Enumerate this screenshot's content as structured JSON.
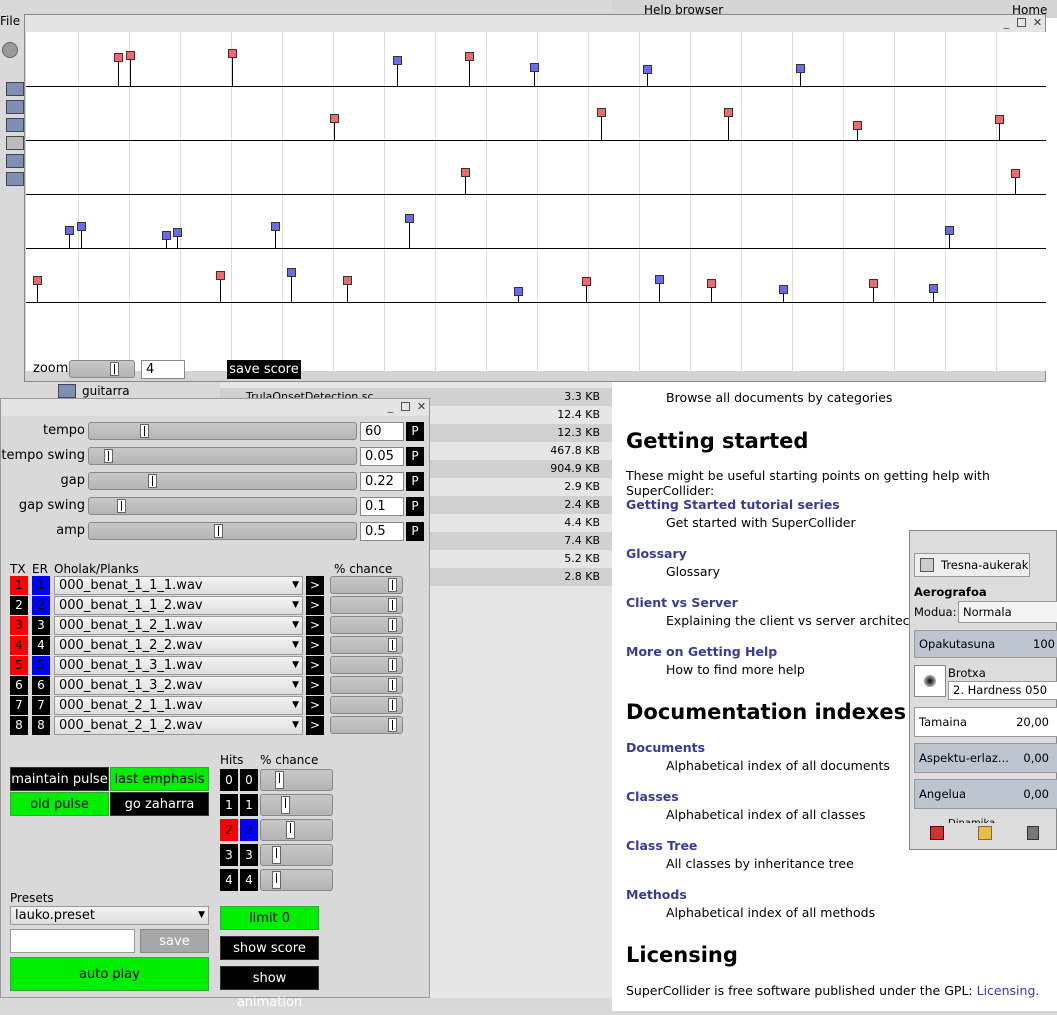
{
  "score_window": {
    "zoom_label": "zoom",
    "zoom_value": "4",
    "zoom_level": 0.42,
    "save_score_label": "save score",
    "num_tracks": 6,
    "events": [
      {
        "track": 0,
        "x": 0.086,
        "h": 0.52,
        "c": "r"
      },
      {
        "track": 0,
        "x": 0.098,
        "h": 0.56,
        "c": "r"
      },
      {
        "track": 0,
        "x": 0.198,
        "h": 0.6,
        "c": "r"
      },
      {
        "track": 0,
        "x": 0.36,
        "h": 0.45,
        "c": "b"
      },
      {
        "track": 0,
        "x": 0.43,
        "h": 0.55,
        "c": "r"
      },
      {
        "track": 0,
        "x": 0.494,
        "h": 0.32,
        "c": "b"
      },
      {
        "track": 0,
        "x": 0.605,
        "h": 0.28,
        "c": "b"
      },
      {
        "track": 0,
        "x": 0.755,
        "h": 0.3,
        "c": "b"
      },
      {
        "track": 1,
        "x": 0.298,
        "h": 0.38,
        "c": "r"
      },
      {
        "track": 1,
        "x": 0.56,
        "h": 0.5,
        "c": "r"
      },
      {
        "track": 1,
        "x": 0.684,
        "h": 0.5,
        "c": "r"
      },
      {
        "track": 1,
        "x": 0.811,
        "h": 0.22,
        "c": "r"
      },
      {
        "track": 1,
        "x": 0.95,
        "h": 0.35,
        "c": "r"
      },
      {
        "track": 2,
        "x": 0.426,
        "h": 0.38,
        "c": "r"
      },
      {
        "track": 2,
        "x": 0.966,
        "h": 0.35,
        "c": "r"
      },
      {
        "track": 3,
        "x": 0.038,
        "h": 0.3,
        "c": "b"
      },
      {
        "track": 3,
        "x": 0.05,
        "h": 0.38,
        "c": "b"
      },
      {
        "track": 3,
        "x": 0.133,
        "h": 0.18,
        "c": "b"
      },
      {
        "track": 3,
        "x": 0.144,
        "h": 0.25,
        "c": "b"
      },
      {
        "track": 3,
        "x": 0.24,
        "h": 0.38,
        "c": "b"
      },
      {
        "track": 3,
        "x": 0.372,
        "h": 0.55,
        "c": "b"
      },
      {
        "track": 3,
        "x": 0.901,
        "h": 0.3,
        "c": "b"
      },
      {
        "track": 4,
        "x": 0.007,
        "h": 0.38,
        "c": "r"
      },
      {
        "track": 4,
        "x": 0.186,
        "h": 0.48,
        "c": "r"
      },
      {
        "track": 4,
        "x": 0.256,
        "h": 0.55,
        "c": "b"
      },
      {
        "track": 4,
        "x": 0.311,
        "h": 0.38,
        "c": "r"
      },
      {
        "track": 4,
        "x": 0.478,
        "h": 0.15,
        "c": "b"
      },
      {
        "track": 4,
        "x": 0.545,
        "h": 0.35,
        "c": "r"
      },
      {
        "track": 4,
        "x": 0.617,
        "h": 0.4,
        "c": "b"
      },
      {
        "track": 4,
        "x": 0.668,
        "h": 0.32,
        "c": "r"
      },
      {
        "track": 4,
        "x": 0.738,
        "h": 0.18,
        "c": "b"
      },
      {
        "track": 4,
        "x": 0.826,
        "h": 0.32,
        "c": "r"
      },
      {
        "track": 4,
        "x": 0.885,
        "h": 0.2,
        "c": "b"
      }
    ]
  },
  "control_window": {
    "sliders": [
      {
        "label": "tempo",
        "value": "60",
        "pos": 0.2
      },
      {
        "label": "tempo swing",
        "value": "0.05",
        "pos": 0.06
      },
      {
        "label": "gap",
        "value": "0.22",
        "pos": 0.23
      },
      {
        "label": "gap swing",
        "value": "0.1",
        "pos": 0.11
      },
      {
        "label": "amp",
        "value": "0.5",
        "pos": 0.49
      }
    ],
    "p_label": "P",
    "headers": {
      "tx": "TX",
      "er": "ER",
      "planks": "Oholak/Planks",
      "chance": "% chance"
    },
    "tracks": [
      {
        "tx": "1",
        "er": "1",
        "txc": "red",
        "erc": "blu",
        "file": "000_benat_1_1_1.wav",
        "chance": 0.92
      },
      {
        "tx": "2",
        "er": "2",
        "txc": "blk",
        "erc": "blu",
        "file": "000_benat_1_1_2.wav",
        "chance": 0.92
      },
      {
        "tx": "3",
        "er": "3",
        "txc": "red",
        "erc": "blk",
        "file": "000_benat_1_2_1.wav",
        "chance": 0.92
      },
      {
        "tx": "4",
        "er": "4",
        "txc": "red",
        "erc": "blk",
        "file": "000_benat_1_2_2.wav",
        "chance": 0.92
      },
      {
        "tx": "5",
        "er": "5",
        "txc": "red",
        "erc": "blu",
        "file": "000_benat_1_3_1.wav",
        "chance": 0.92
      },
      {
        "tx": "6",
        "er": "6",
        "txc": "blk",
        "erc": "blk",
        "file": "000_benat_1_3_2.wav",
        "chance": 0.92
      },
      {
        "tx": "7",
        "er": "7",
        "txc": "blk",
        "erc": "blk",
        "file": "000_benat_2_1_1.wav",
        "chance": 0.92
      },
      {
        "tx": "8",
        "er": "8",
        "txc": "blk",
        "erc": "blk",
        "file": "000_benat_2_1_2.wav",
        "chance": 0.92
      }
    ],
    "go_label": ">",
    "maintain_pulse": "maintain pulse",
    "last_emphasis": "last emphasis",
    "old_pulse": "old pulse",
    "go_zaharra": "go zaharra",
    "hits_label": "Hits",
    "hits_chance_label": "% chance",
    "hits": [
      {
        "a": "0",
        "b": "0",
        "ac": "blk",
        "bc": "blk",
        "chance": 0.22
      },
      {
        "a": "1",
        "b": "1",
        "ac": "blk",
        "bc": "blk",
        "chance": 0.32
      },
      {
        "a": "2",
        "b": "2",
        "ac": "red",
        "bc": "blu",
        "chance": 0.4
      },
      {
        "a": "3",
        "b": "3",
        "ac": "blk",
        "bc": "blk",
        "chance": 0.18
      },
      {
        "a": "4",
        "b": "4",
        "ac": "blk",
        "bc": "blk",
        "chance": 0.18
      }
    ],
    "presets_label": "Presets",
    "preset_value": "lauko.preset",
    "preset_name_input": "",
    "save_label": "save",
    "auto_play": "auto play",
    "limit": "limit 0",
    "show_score": "show score",
    "show_animation": "show animation"
  },
  "file_list": {
    "rows": [
      {
        "name": "TrulaOnsetDetection.sc",
        "size": "3.3 KB"
      },
      {
        "name": "",
        "size": "12.4 KB"
      },
      {
        "name": "",
        "size": "12.3 KB"
      },
      {
        "name": "",
        "size": "467.8 KB"
      },
      {
        "name": "",
        "size": "904.9 KB"
      },
      {
        "name": "",
        "size": "2.9 KB"
      },
      {
        "name": "",
        "size": "2.4 KB"
      },
      {
        "name": "",
        "size": "4.4 KB"
      },
      {
        "name": "",
        "size": "7.4 KB"
      },
      {
        "name": "",
        "size": "5.2 KB"
      },
      {
        "name": "",
        "size": "2.8 KB"
      }
    ],
    "folder_label": "guitarra"
  },
  "help_browser": {
    "title": "Help browser",
    "home": "Home",
    "browse_desc": "Browse all documents by categories",
    "getting_started": "Getting started",
    "getting_started_intro": "These might be useful starting points on getting help with SuperCollider:",
    "gs_links": [
      {
        "title": "Getting Started tutorial series",
        "desc": "Get started with SuperCollider"
      },
      {
        "title": "Glossary",
        "desc": "Glossary"
      },
      {
        "title": "Client vs Server",
        "desc": "Explaining the client vs server architecture"
      },
      {
        "title": "More on Getting Help",
        "desc": "How to find more help"
      }
    ],
    "doc_indexes": "Documentation indexes",
    "idx_links": [
      {
        "title": "Documents",
        "desc": "Alphabetical index of all documents"
      },
      {
        "title": "Classes",
        "desc": "Alphabetical index of all classes"
      },
      {
        "title": "Class Tree",
        "desc": "All classes by inheritance tree"
      },
      {
        "title": "Methods",
        "desc": "Alphabetical index of all methods"
      }
    ],
    "licensing": "Licensing",
    "licensing_text": "SuperCollider is free software published under the GPL:",
    "licensing_link": "Licensing."
  },
  "tool_window": {
    "tab": "Tresna-aukerak",
    "tool_name": "Aerografoa",
    "mode_label": "Modua:",
    "mode_value": "Normala",
    "opacity_label": "Opakutasuna",
    "opacity_value": "100",
    "brush_label": "Brotxa",
    "brush_value": "2. Hardness 050",
    "size_label": "Tamaina",
    "size_value": "20,00",
    "aspect_label": "Aspektu-erlaz...",
    "aspect_value": "0,00",
    "angle_label": "Angelua",
    "angle_value": "0,00",
    "dynamics_label": "Dinamika"
  },
  "menu": {
    "file": "File"
  }
}
